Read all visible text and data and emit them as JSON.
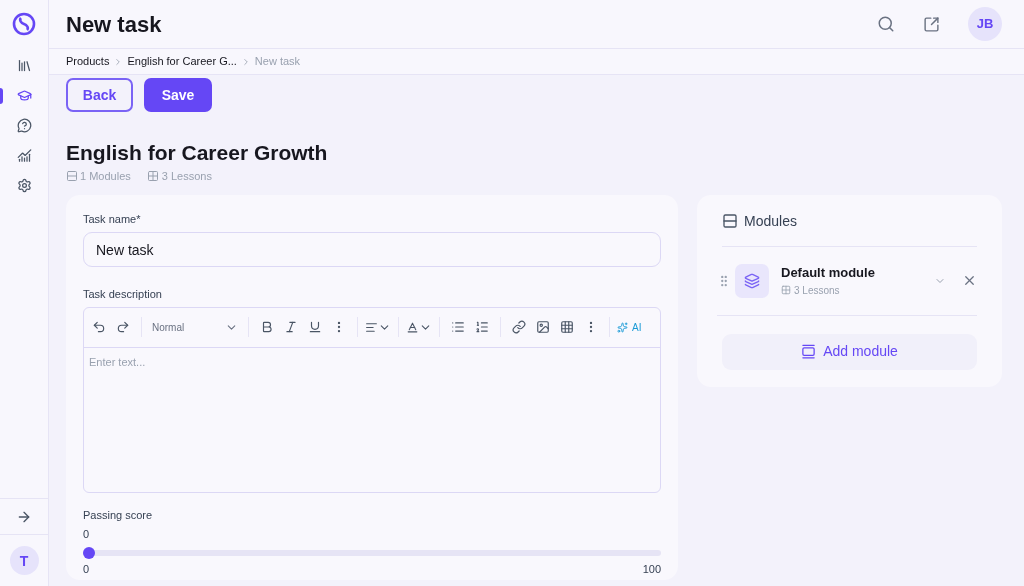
{
  "sidebar": {
    "items": [
      {
        "selected": false
      },
      {
        "selected": true
      },
      {
        "selected": false
      },
      {
        "selected": false
      },
      {
        "selected": false
      }
    ],
    "user_initial": "T"
  },
  "header": {
    "title": "New task",
    "avatar": "JB"
  },
  "breadcrumb": [
    {
      "label": "Products",
      "current": false
    },
    {
      "label": "English for Career G...",
      "current": false
    },
    {
      "label": "New task",
      "current": true
    }
  ],
  "actions": [
    {
      "label": "Back",
      "kind": "outline"
    },
    {
      "label": "Save",
      "kind": "primary"
    }
  ],
  "product": {
    "title": "English for Career Growth",
    "modules": "1 Modules",
    "lessons": "3 Lessons"
  },
  "form": {
    "name_label": "Task name*",
    "name_value": "New task",
    "description_label": "Task description",
    "style_select": "Normal",
    "ai_label": "AI",
    "editor_placeholder": "Enter text...",
    "passing_label": "Passing score",
    "passing_value": "0",
    "slider": {
      "level": 0,
      "min": "0",
      "max": "100"
    }
  },
  "modules_panel": {
    "title": "Modules",
    "items": [
      {
        "name": "Default module",
        "lessons": "3 Lessons"
      }
    ],
    "add_label": "Add module"
  }
}
